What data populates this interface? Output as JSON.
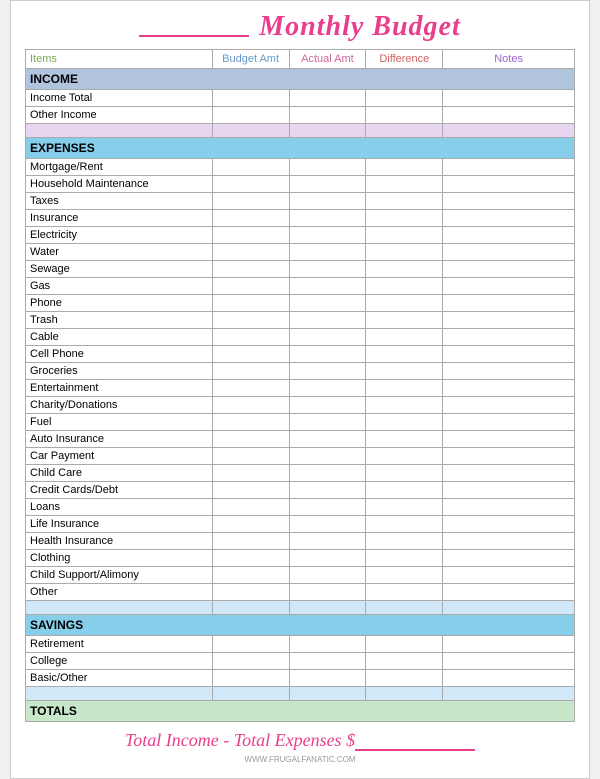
{
  "header": {
    "title": "Monthly Budget"
  },
  "columns": {
    "items": "Items",
    "budget_amt": "Budget Amt",
    "actual_amt": "Actual Amt",
    "difference": "Difference",
    "notes": "Notes"
  },
  "sections": {
    "income": {
      "label": "INCOME",
      "rows": [
        "Income Total",
        "Other Income"
      ]
    },
    "expenses": {
      "label": "EXPENSES",
      "rows": [
        "Mortgage/Rent",
        "Household Maintenance",
        "Taxes",
        "Insurance",
        "Electricity",
        "Water",
        "Sewage",
        "Gas",
        "Phone",
        "Trash",
        "Cable",
        "Cell Phone",
        "Groceries",
        "Entertainment",
        "Charity/Donations",
        "Fuel",
        "Auto Insurance",
        "Car Payment",
        "Child Care",
        "Credit Cards/Debt",
        "Loans",
        "Life Insurance",
        "Health Insurance",
        "Clothing",
        "Child Support/Alimony",
        "Other"
      ]
    },
    "savings": {
      "label": "SAVINGS",
      "rows": [
        "Retirement",
        "College",
        "Basic/Other"
      ]
    },
    "totals": {
      "label": "TOTALS"
    }
  },
  "footer": {
    "text_before": "Total Income - Total Expenses $",
    "underline_placeholder": "________"
  },
  "watermark": "WWW.FRUGALFANATIC.COM"
}
